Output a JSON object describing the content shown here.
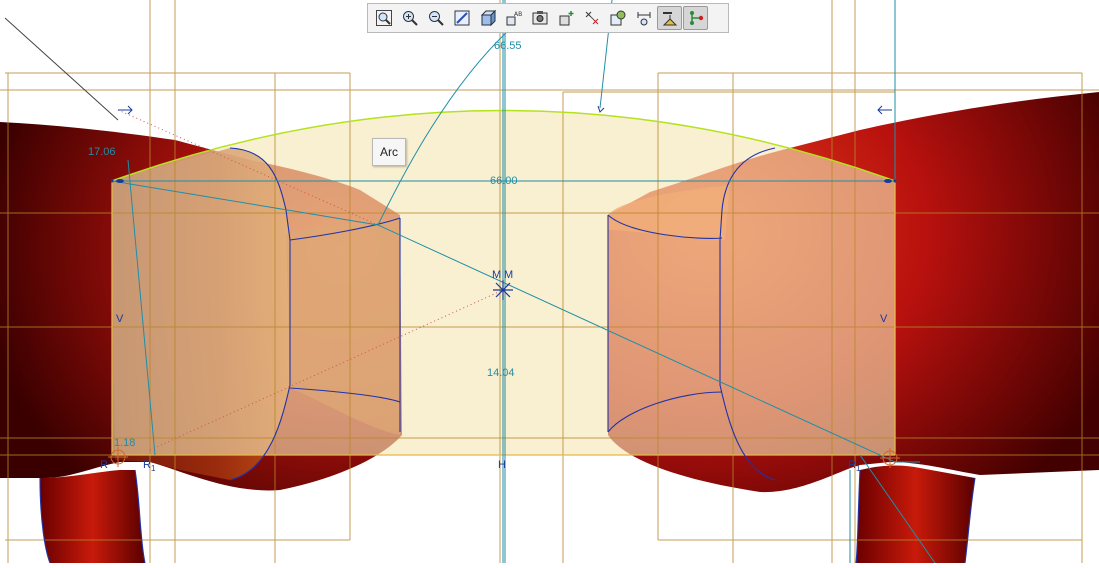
{
  "tooltip": {
    "text": "Arc"
  },
  "toolbar": {
    "buttons": [
      {
        "name": "zoom-fit-icon",
        "active": false
      },
      {
        "name": "zoom-in-icon",
        "active": false
      },
      {
        "name": "zoom-out-icon",
        "active": false
      },
      {
        "name": "repaint-icon",
        "active": false
      },
      {
        "name": "orient-icon",
        "active": false
      },
      {
        "name": "saved-views-icon",
        "active": false
      },
      {
        "name": "display-style-icon",
        "active": false
      },
      {
        "name": "datum-display-icon",
        "active": false
      },
      {
        "name": "point-display-icon",
        "active": false
      },
      {
        "name": "csys-display-icon",
        "active": false
      },
      {
        "name": "annotation-display-icon",
        "active": false
      },
      {
        "name": "constraint-display-icon",
        "active": true
      },
      {
        "name": "vertex-display-icon",
        "active": true
      }
    ]
  },
  "dimensions": {
    "top": "66.55",
    "width": "66.00",
    "left_offset": "17.06",
    "height": "14.04",
    "bottom_left": "1.18"
  },
  "constraints": {
    "vertical": "V",
    "horizontal": "H",
    "midpoint": "M",
    "radius": "R",
    "radius_sub": "1"
  },
  "colors": {
    "sketch_fill": "#f6e7b4",
    "arc": "#b5e21f",
    "dimension": "#1f8ea8",
    "constraint": "#1a3a9a",
    "grid": "#b8862a"
  }
}
